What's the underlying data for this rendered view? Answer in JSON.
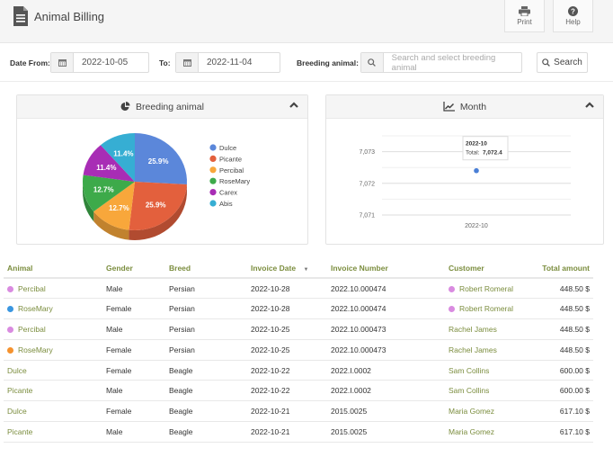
{
  "header": {
    "title": "Animal Billing",
    "print_label": "Print",
    "help_label": "Help"
  },
  "filters": {
    "date_from_label": "Date From:",
    "date_from_value": "2022-10-05",
    "to_label": "To:",
    "to_value": "2022-11-04",
    "breeding_label": "Breeding animal:",
    "breeding_placeholder": "Search and select breeding animal",
    "search_label": "Search"
  },
  "panels": {
    "pie_title": "Breeding animal",
    "line_title": "Month"
  },
  "colors": {
    "accent_green": "#7b8d3e",
    "dulce": "#5b87da",
    "picante": "#e3603d",
    "percibal": "#f8a73b",
    "rosemary": "#3daa4a",
    "carex": "#a82db5",
    "abis": "#36aed3"
  },
  "chart_data": [
    {
      "type": "pie",
      "title": "Breeding animal",
      "legend_position": "right",
      "categories": [
        "Dulce",
        "Picante",
        "Percibal",
        "RoseMary",
        "Carex",
        "Abis"
      ],
      "values": [
        25.9,
        25.9,
        12.7,
        12.7,
        11.4,
        11.4
      ],
      "labels": [
        "25.9%",
        "25.9%",
        "12.7%",
        "12.7%",
        "11.4%",
        "11.4%"
      ],
      "colors": [
        "#5b87da",
        "#e3603d",
        "#f8a73b",
        "#3daa4a",
        "#a82db5",
        "#36aed3"
      ]
    },
    {
      "type": "line",
      "title": "Month",
      "x": [
        "2022-10"
      ],
      "series": [
        {
          "name": "Total",
          "values": [
            7072.4
          ]
        }
      ],
      "ylim": [
        7071,
        7073.5
      ],
      "yticks": [
        "7,071",
        "7,072",
        "7,073"
      ],
      "ytick_values": [
        7071,
        7072,
        7073
      ],
      "xtick_labels": [
        "2022-10"
      ],
      "grid": true,
      "tooltip": {
        "title": "2022-10",
        "label": "Total:",
        "value": "7,072.4"
      }
    }
  ],
  "table": {
    "columns": [
      "Animal",
      "Gender",
      "Breed",
      "Invoice Date",
      "Invoice Number",
      "Customer",
      "Total amount"
    ],
    "rows": [
      {
        "animal": "Percibal",
        "animal_dot": "#d98be0",
        "gender": "Male",
        "breed": "Persian",
        "date": "2022-10-28",
        "invoice": "2022.10.000474",
        "customer": "Robert Romeral",
        "customer_dot": "#d98be0",
        "amount": "448.50 $"
      },
      {
        "animal": "RoseMary",
        "animal_dot": "#3a96e0",
        "gender": "Female",
        "breed": "Persian",
        "date": "2022-10-28",
        "invoice": "2022.10.000474",
        "customer": "Robert Romeral",
        "customer_dot": "#d98be0",
        "amount": "448.50 $"
      },
      {
        "animal": "Percibal",
        "animal_dot": "#d98be0",
        "gender": "Male",
        "breed": "Persian",
        "date": "2022-10-25",
        "invoice": "2022.10.000473",
        "customer": "Rachel James",
        "customer_dot": "",
        "amount": "448.50 $"
      },
      {
        "animal": "RoseMary",
        "animal_dot": "#f5922e",
        "gender": "Female",
        "breed": "Persian",
        "date": "2022-10-25",
        "invoice": "2022.10.000473",
        "customer": "Rachel James",
        "customer_dot": "",
        "amount": "448.50 $"
      },
      {
        "animal": "Dulce",
        "animal_dot": "",
        "gender": "Female",
        "breed": "Beagle",
        "date": "2022-10-22",
        "invoice": "2022.I.0002",
        "customer": "Sam Collins",
        "customer_dot": "",
        "amount": "600.00 $"
      },
      {
        "animal": "Picante",
        "animal_dot": "",
        "gender": "Male",
        "breed": "Beagle",
        "date": "2022-10-22",
        "invoice": "2022.I.0002",
        "customer": "Sam Collins",
        "customer_dot": "",
        "amount": "600.00 $"
      },
      {
        "animal": "Dulce",
        "animal_dot": "",
        "gender": "Female",
        "breed": "Beagle",
        "date": "2022-10-21",
        "invoice": "2015.0025",
        "customer": "Maria Gomez",
        "customer_dot": "",
        "amount": "617.10 $"
      },
      {
        "animal": "Picante",
        "animal_dot": "",
        "gender": "Male",
        "breed": "Beagle",
        "date": "2022-10-21",
        "invoice": "2015.0025",
        "customer": "Maria Gomez",
        "customer_dot": "",
        "amount": "617.10 $"
      }
    ]
  }
}
